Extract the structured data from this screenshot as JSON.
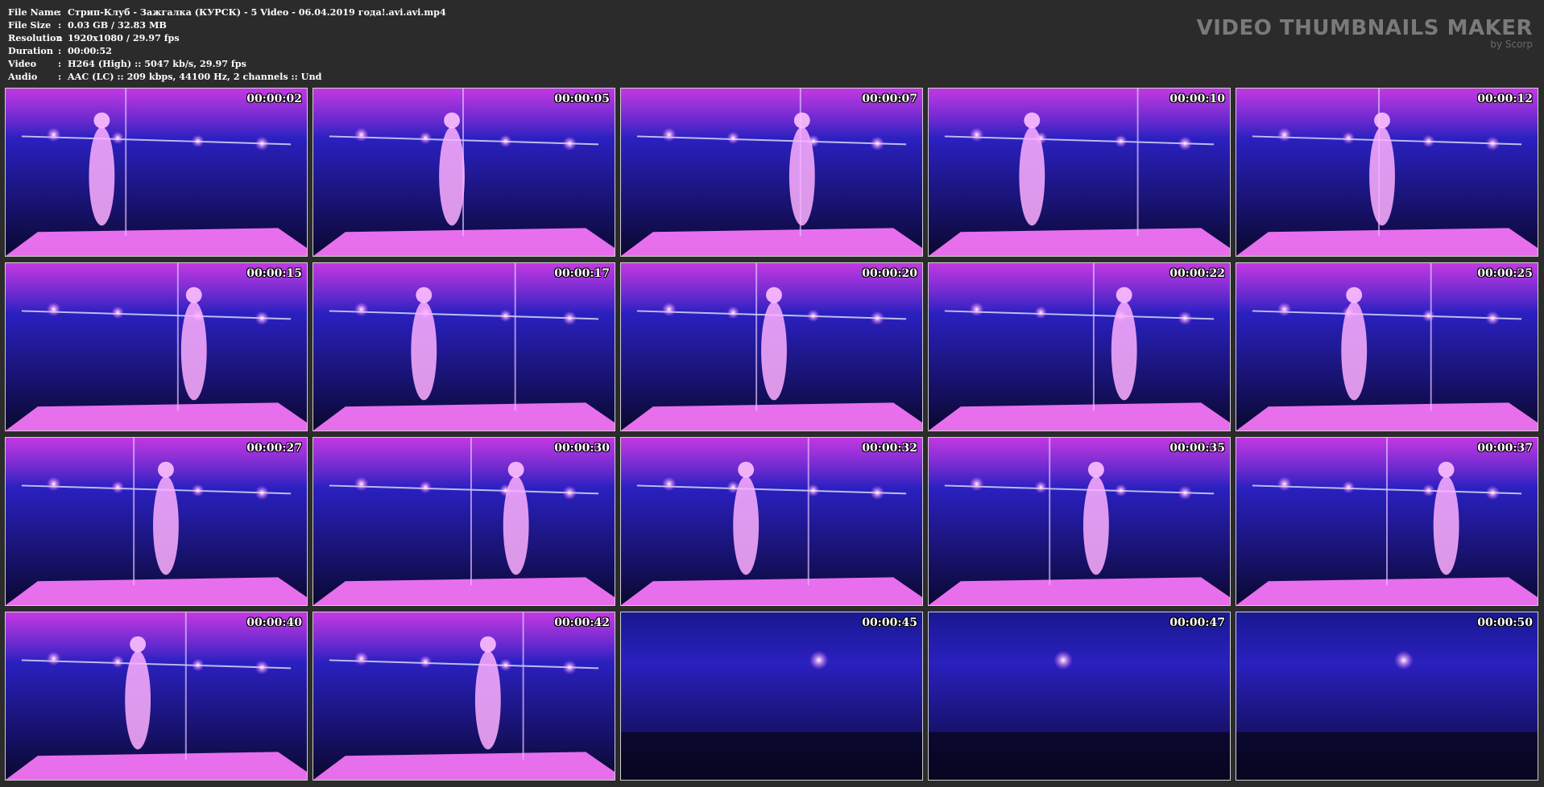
{
  "info": [
    {
      "label": "File Name",
      "value": "Стрип-Клуб - Зажгалка (КУРСК) - 5 Video - 06.04.2019 года!.avi.avi.mp4"
    },
    {
      "label": "File Size",
      "value": "0.03 GB  / 32.83 MB"
    },
    {
      "label": "Resolution",
      "value": "1920x1080 / 29.97 fps"
    },
    {
      "label": "Duration",
      "value": "00:00:52"
    },
    {
      "label": "Video",
      "value": "H264 (High) :: 5047 kb/s, 29.97 fps"
    },
    {
      "label": "Audio",
      "value": "AAC (LC) :: 209 kbps, 44100 Hz, 2 channels :: Und"
    }
  ],
  "separator": ":",
  "brand": {
    "title": "VIDEO THUMBNAILS MAKER",
    "subtitle": "by Scorp"
  },
  "thumbnails": [
    {
      "time": "00:00:02"
    },
    {
      "time": "00:00:05"
    },
    {
      "time": "00:00:07"
    },
    {
      "time": "00:00:10"
    },
    {
      "time": "00:00:12"
    },
    {
      "time": "00:00:15"
    },
    {
      "time": "00:00:17"
    },
    {
      "time": "00:00:20"
    },
    {
      "time": "00:00:22"
    },
    {
      "time": "00:00:25"
    },
    {
      "time": "00:00:27"
    },
    {
      "time": "00:00:30"
    },
    {
      "time": "00:00:32"
    },
    {
      "time": "00:00:35"
    },
    {
      "time": "00:00:37"
    },
    {
      "time": "00:00:40"
    },
    {
      "time": "00:00:42"
    },
    {
      "time": "00:00:45"
    },
    {
      "time": "00:00:47"
    },
    {
      "time": "00:00:50"
    }
  ],
  "colors": {
    "background": "#2b2b2b",
    "stage_magenta": "#e040ff",
    "stage_blue": "#2a20c0",
    "dark_blue": "#0a0830"
  }
}
